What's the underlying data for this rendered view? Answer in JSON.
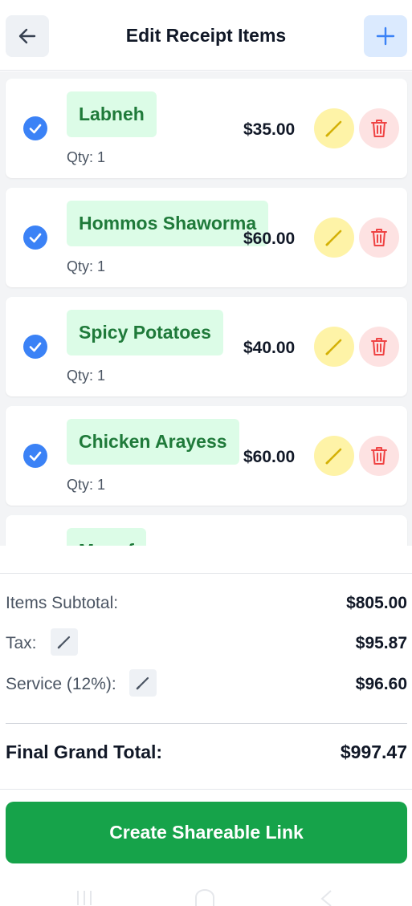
{
  "header": {
    "title": "Edit Receipt Items",
    "back_icon": "arrow-left-icon",
    "add_icon": "plus-icon"
  },
  "items": [
    {
      "name": "Labneh",
      "qty": "Qty: 1",
      "price": "$35.00",
      "checked": true
    },
    {
      "name": "Hommos Shaworma",
      "qty": "Qty: 1",
      "price": "$60.00",
      "checked": true
    },
    {
      "name": "Spicy Potatoes",
      "qty": "Qty: 1",
      "price": "$40.00",
      "checked": true
    },
    {
      "name": "Chicken Arayess",
      "qty": "Qty: 1",
      "price": "$60.00",
      "checked": true
    },
    {
      "name": "Mnoof",
      "qty": "",
      "price": "",
      "checked": true
    }
  ],
  "summary": {
    "subtotal_label": "Items Subtotal:",
    "subtotal_value": "$805.00",
    "tax_label": "Tax:",
    "tax_value": "$95.87",
    "service_label": "Service (12%):",
    "service_value": "$96.60",
    "grand_label": "Final Grand Total:",
    "grand_value": "$997.47"
  },
  "actions": {
    "share_label": "Create Shareable Link"
  },
  "colors": {
    "accent_blue": "#3b82f6",
    "pill_green": "#dcfce7",
    "text_green": "#1f7a3a",
    "edit_yellow": "#fef3a7",
    "delete_red": "#fde2e2",
    "button_green": "#16a34a"
  }
}
